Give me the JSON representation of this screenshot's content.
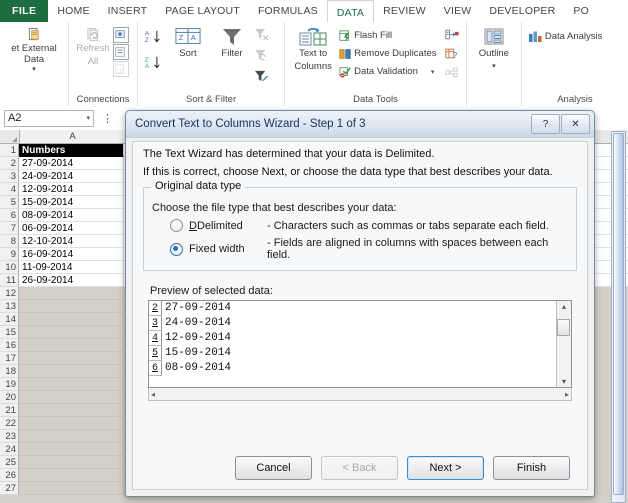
{
  "ribbon": {
    "tabs": [
      {
        "label": "FILE",
        "kind": "file"
      },
      {
        "label": "HOME",
        "kind": "normal"
      },
      {
        "label": "INSERT",
        "kind": "normal"
      },
      {
        "label": "PAGE LAYOUT",
        "kind": "normal"
      },
      {
        "label": "FORMULAS",
        "kind": "normal"
      },
      {
        "label": "DATA",
        "kind": "active"
      },
      {
        "label": "REVIEW",
        "kind": "normal"
      },
      {
        "label": "VIEW",
        "kind": "normal"
      },
      {
        "label": "DEVELOPER",
        "kind": "normal"
      },
      {
        "label": "PO",
        "kind": "normal"
      }
    ],
    "groups": {
      "external": {
        "button": "et External Data",
        "caret": "▾",
        "title": ""
      },
      "connections": {
        "refresh": "Refresh",
        "refresh2": "All",
        "caret": "▾",
        "title": "Connections"
      },
      "sort_filter": {
        "sort": "Sort",
        "filter": "Filter",
        "title": "Sort & Filter",
        "az": "A\nZ",
        "za": "Z\nA"
      },
      "data_tools": {
        "text_to": "Text to",
        "columns": "Columns",
        "flash_fill": "Flash Fill",
        "remove_duplicates": "Remove Duplicates",
        "data_validation": "Data Validation",
        "dv_caret": "▾",
        "title": "Data Tools"
      },
      "outline": {
        "label": "Outline",
        "caret": "▾",
        "title": ""
      },
      "analysis": {
        "data_analysis": "Data Analysis",
        "title": "Analysis"
      }
    }
  },
  "formula_bar": {
    "name_box_value": "A2",
    "name_box_caret": "▾",
    "more_dots": "⋮"
  },
  "sheet": {
    "column_header": "A",
    "rows": [
      {
        "num": "1",
        "value": "Numbers",
        "selected": true
      },
      {
        "num": "2",
        "value": "27-09-2014",
        "selected": false
      },
      {
        "num": "3",
        "value": "24-09-2014",
        "selected": false
      },
      {
        "num": "4",
        "value": "12-09-2014",
        "selected": false
      },
      {
        "num": "5",
        "value": "15-09-2014",
        "selected": false
      },
      {
        "num": "6",
        "value": "08-09-2014",
        "selected": false
      },
      {
        "num": "7",
        "value": "06-09-2014",
        "selected": false
      },
      {
        "num": "8",
        "value": "12-10-2014",
        "selected": false
      },
      {
        "num": "9",
        "value": "16-09-2014",
        "selected": false
      },
      {
        "num": "10",
        "value": "11-09-2014",
        "selected": false
      },
      {
        "num": "11",
        "value": "26-09-2014",
        "selected": false
      },
      {
        "num": "12",
        "value": "",
        "selected": false
      },
      {
        "num": "13",
        "value": "",
        "selected": false
      },
      {
        "num": "14",
        "value": "",
        "selected": false
      },
      {
        "num": "15",
        "value": "",
        "selected": false
      },
      {
        "num": "16",
        "value": "",
        "selected": false
      },
      {
        "num": "17",
        "value": "",
        "selected": false
      },
      {
        "num": "18",
        "value": "",
        "selected": false
      },
      {
        "num": "19",
        "value": "",
        "selected": false
      },
      {
        "num": "20",
        "value": "",
        "selected": false
      },
      {
        "num": "21",
        "value": "",
        "selected": false
      },
      {
        "num": "22",
        "value": "",
        "selected": false
      },
      {
        "num": "23",
        "value": "",
        "selected": false
      },
      {
        "num": "24",
        "value": "",
        "selected": false
      },
      {
        "num": "25",
        "value": "",
        "selected": false
      },
      {
        "num": "26",
        "value": "",
        "selected": false
      },
      {
        "num": "27",
        "value": "",
        "selected": false
      }
    ]
  },
  "dialog": {
    "title": "Convert Text to Columns Wizard - Step 1 of 3",
    "help_button": "?",
    "close_button": "✕",
    "line1": "The Text Wizard has determined that your data is Delimited.",
    "line2": "If this is correct, choose Next, or choose the data type that best describes your data.",
    "group_label": "Original data type",
    "group_instruction": "Choose the file type that best describes your data:",
    "options": [
      {
        "name": "Delimited",
        "desc": "- Characters such as commas or tabs separate each field.",
        "selected": false
      },
      {
        "name": "Fixed width",
        "desc": "- Fields are aligned in columns with spaces between each field.",
        "selected": true
      }
    ],
    "preview_label": "Preview of selected data:",
    "preview_rows": [
      {
        "num": "2",
        "value": "27-09-2014"
      },
      {
        "num": "3",
        "value": "24-09-2014"
      },
      {
        "num": "4",
        "value": "12-09-2014"
      },
      {
        "num": "5",
        "value": "15-09-2014"
      },
      {
        "num": "6",
        "value": "08-09-2014"
      }
    ],
    "scroll_up": "▴",
    "scroll_down": "▾",
    "scroll_left": "◂",
    "scroll_right": "▸",
    "buttons": [
      {
        "label": "Cancel",
        "state": "normal"
      },
      {
        "label": "< Back",
        "state": "disabled"
      },
      {
        "label": "Next >",
        "state": "default"
      },
      {
        "label": "Finish",
        "state": "normal"
      }
    ]
  },
  "colors": {
    "excel_green": "#217346",
    "file_tab_green": "#1e6c41",
    "accent_blue": "#1a74c9",
    "selection_black": "#000000"
  }
}
